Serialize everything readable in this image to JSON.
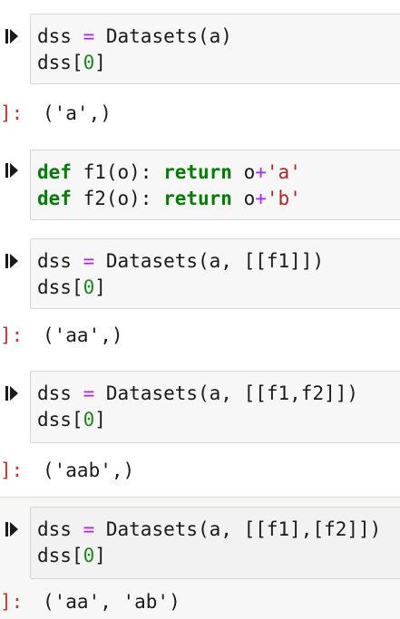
{
  "cells": [
    {
      "code_lines": [
        [
          {
            "t": "dss "
          },
          {
            "t": "=",
            "c": "op"
          },
          {
            "t": " Datasets(a)"
          }
        ],
        [
          {
            "t": "dss["
          },
          {
            "t": "0",
            "c": "num"
          },
          {
            "t": "]"
          }
        ]
      ],
      "output_prompt": "]:",
      "output": "('a',)"
    },
    {
      "code_lines": [
        [
          {
            "t": "def",
            "c": "kw"
          },
          {
            "t": " f1(o): "
          },
          {
            "t": "return",
            "c": "kw"
          },
          {
            "t": " o"
          },
          {
            "t": "+",
            "c": "op"
          },
          {
            "t": "'a'",
            "c": "str"
          }
        ],
        [
          {
            "t": "def",
            "c": "kw"
          },
          {
            "t": " f2(o): "
          },
          {
            "t": "return",
            "c": "kw"
          },
          {
            "t": " o"
          },
          {
            "t": "+",
            "c": "op"
          },
          {
            "t": "'b'",
            "c": "str"
          }
        ]
      ],
      "output_prompt": "",
      "output": ""
    },
    {
      "code_lines": [
        [
          {
            "t": "dss "
          },
          {
            "t": "=",
            "c": "op"
          },
          {
            "t": " Datasets(a, [[f1]])"
          }
        ],
        [
          {
            "t": "dss["
          },
          {
            "t": "0",
            "c": "num"
          },
          {
            "t": "]"
          }
        ]
      ],
      "output_prompt": "]:",
      "output": "('aa',)"
    },
    {
      "code_lines": [
        [
          {
            "t": "dss "
          },
          {
            "t": "=",
            "c": "op"
          },
          {
            "t": " Datasets(a, [[f1,f2]])"
          }
        ],
        [
          {
            "t": "dss["
          },
          {
            "t": "0",
            "c": "num"
          },
          {
            "t": "]"
          }
        ]
      ],
      "output_prompt": "]:",
      "output": "('aab',)"
    },
    {
      "code_lines": [
        [
          {
            "t": "dss "
          },
          {
            "t": "=",
            "c": "op"
          },
          {
            "t": " Datasets(a, [[f1],[f2]])"
          }
        ],
        [
          {
            "t": "dss["
          },
          {
            "t": "0",
            "c": "num"
          },
          {
            "t": "]"
          }
        ]
      ],
      "output_prompt": "]:",
      "output": "('aa', 'ab')"
    }
  ]
}
